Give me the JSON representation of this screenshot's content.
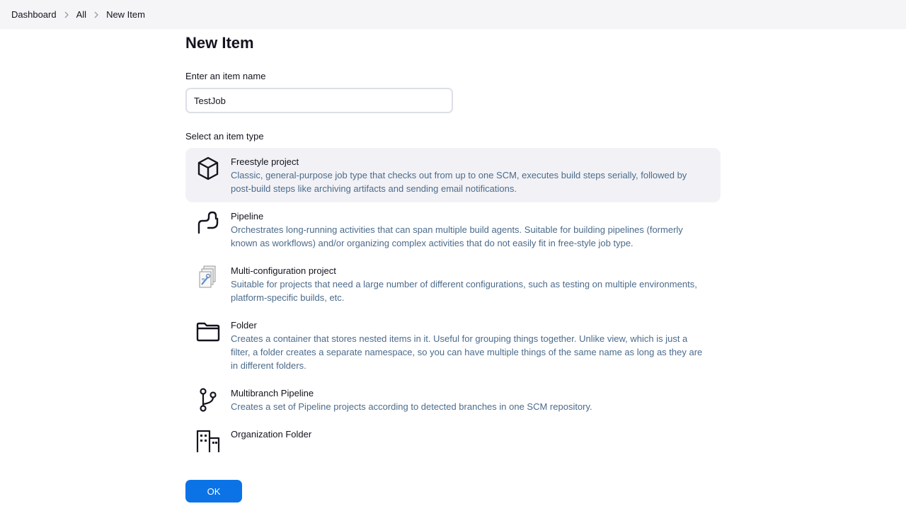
{
  "breadcrumb": {
    "items": [
      "Dashboard",
      "All",
      "New Item"
    ]
  },
  "page": {
    "title": "New Item",
    "name_label": "Enter an item name",
    "name_value": "TestJob",
    "type_label": "Select an item type"
  },
  "item_types": [
    {
      "title": "Freestyle project",
      "desc": "Classic, general-purpose job type that checks out from up to one SCM, executes build steps serially, followed by post-build steps like archiving artifacts and sending email notifications.",
      "icon": "box-icon",
      "selected": true
    },
    {
      "title": "Pipeline",
      "desc": "Orchestrates long-running activities that can span multiple build agents. Suitable for building pipelines (formerly known as workflows) and/or organizing complex activities that do not easily fit in free-style job type.",
      "icon": "pipeline-icon",
      "selected": false
    },
    {
      "title": "Multi-configuration project",
      "desc": "Suitable for projects that need a large number of different configurations, such as testing on multiple environments, platform-specific builds, etc.",
      "icon": "multi-config-icon",
      "selected": false
    },
    {
      "title": "Folder",
      "desc": "Creates a container that stores nested items in it. Useful for grouping things together. Unlike view, which is just a filter, a folder creates a separate namespace, so you can have multiple things of the same name as long as they are in different folders.",
      "icon": "folder-icon",
      "selected": false
    },
    {
      "title": "Multibranch Pipeline",
      "desc": "Creates a set of Pipeline projects according to detected branches in one SCM repository.",
      "icon": "branch-icon",
      "selected": false
    },
    {
      "title": "Organization Folder",
      "desc": "",
      "icon": "building-icon",
      "selected": false
    }
  ],
  "footer": {
    "ok_label": "OK"
  },
  "colors": {
    "accent": "#0b73e6",
    "desc_text": "#4b6b8b",
    "selected_bg": "#f2f2f6",
    "topbar_bg": "#f5f5f7"
  }
}
